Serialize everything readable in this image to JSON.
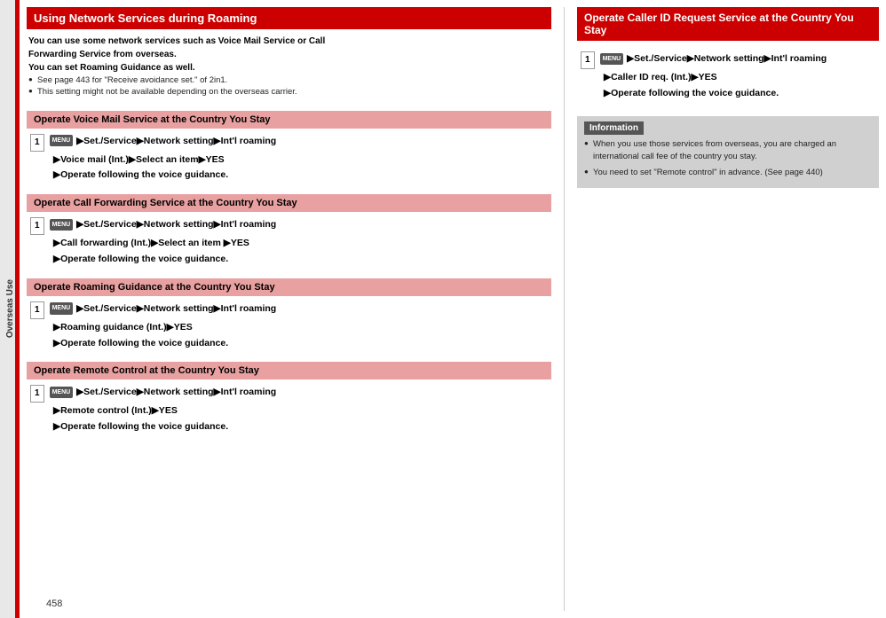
{
  "sidebar": {
    "label": "Overseas Use",
    "page_number": "458"
  },
  "left": {
    "header": "Using Network Services during Roaming",
    "intro": {
      "line1": "You can use some network services such as Voice Mail Service or Call",
      "line2": "Forwarding Service from overseas.",
      "line3": "You can set Roaming Guidance as well.",
      "bullet1": "See page 443 for \"Receive avoidance set.\" of 2in1.",
      "bullet2": "This setting might not be available depending on the overseas carrier."
    },
    "sections": [
      {
        "title": "Operate Voice Mail Service at the Country You Stay",
        "step_num": "1",
        "lines": [
          "MENU ▶Set./Service▶Network setting▶Int'l roaming",
          "▶Voice mail (Int.)▶Select an item▶YES",
          "▶Operate following the voice guidance."
        ]
      },
      {
        "title": "Operate Call Forwarding Service at the Country You Stay",
        "step_num": "1",
        "lines": [
          "MENU ▶Set./Service▶Network setting▶Int'l roaming",
          "▶Call forwarding (Int.)▶Select an item ▶YES",
          "▶Operate following the voice guidance."
        ]
      },
      {
        "title": "Operate Roaming Guidance at the Country You Stay",
        "step_num": "1",
        "lines": [
          "MENU ▶Set./Service▶Network setting▶Int'l roaming",
          "▶Roaming guidance (Int.)▶YES",
          "▶Operate following the voice guidance."
        ]
      },
      {
        "title": "Operate Remote Control at the Country You Stay",
        "step_num": "1",
        "lines": [
          "MENU ▶Set./Service▶Network setting▶Int'l roaming",
          "▶Remote control (Int.)▶YES",
          "▶Operate following the voice guidance."
        ]
      }
    ]
  },
  "right": {
    "header": "Operate Caller ID Request Service at the Country You Stay",
    "step_num": "1",
    "lines": [
      "MENU ▶Set./Service▶Network setting▶Int'l roaming",
      "▶Caller ID req. (Int.)▶YES",
      "▶Operate following the voice guidance."
    ],
    "info": {
      "label": "Information",
      "bullets": [
        "When you use those services from overseas, you are charged an international call fee of the country you stay.",
        "You need to set \"Remote control\" in advance. (See page 440)"
      ]
    }
  }
}
